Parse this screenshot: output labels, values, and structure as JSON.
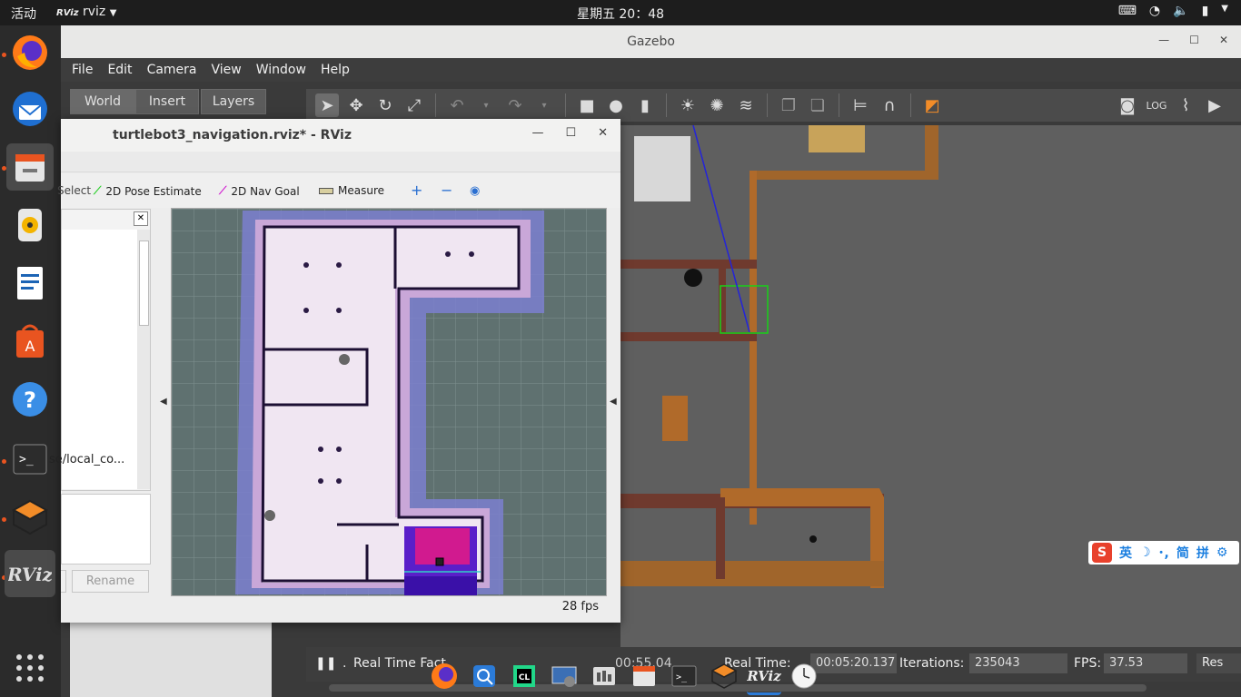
{
  "topbar": {
    "activities": "活动",
    "app_name": "rviz",
    "app_badge": "RViz",
    "clock": "星期五 20：48"
  },
  "gazebo": {
    "title": "Gazebo",
    "menu": [
      "File",
      "Edit",
      "Camera",
      "View",
      "Window",
      "Help"
    ],
    "tabs": [
      "World",
      "Insert",
      "Layers"
    ],
    "status": {
      "real_time_factor_label": "Real Time Fact",
      "real_time_label": "Real Time:",
      "real_time_value": "00:05:20.137",
      "sim_time_partial": "00:55.04",
      "iterations_label": "Iterations:",
      "iterations_value": "235043",
      "fps_label": "FPS:",
      "fps_value": "37.53",
      "reset_label": "Res"
    }
  },
  "rviz": {
    "title": "turtlebot3_navigation.rviz* - RViz",
    "tools": {
      "select": "Select",
      "pose_estimate": "2D Pose Estimate",
      "nav_goal": "2D Nav Goal",
      "measure": "Measure"
    },
    "display_item": "se/local_co...",
    "rename_label": "Rename",
    "fps": "28 fps"
  },
  "ime": {
    "lang": "英",
    "mode": "简",
    "pinyin": "拼"
  },
  "colors": {
    "ubuntu_orange": "#e95420",
    "gazebo_panel": "#3a3a3a",
    "rviz_grid": "#5f7170"
  }
}
